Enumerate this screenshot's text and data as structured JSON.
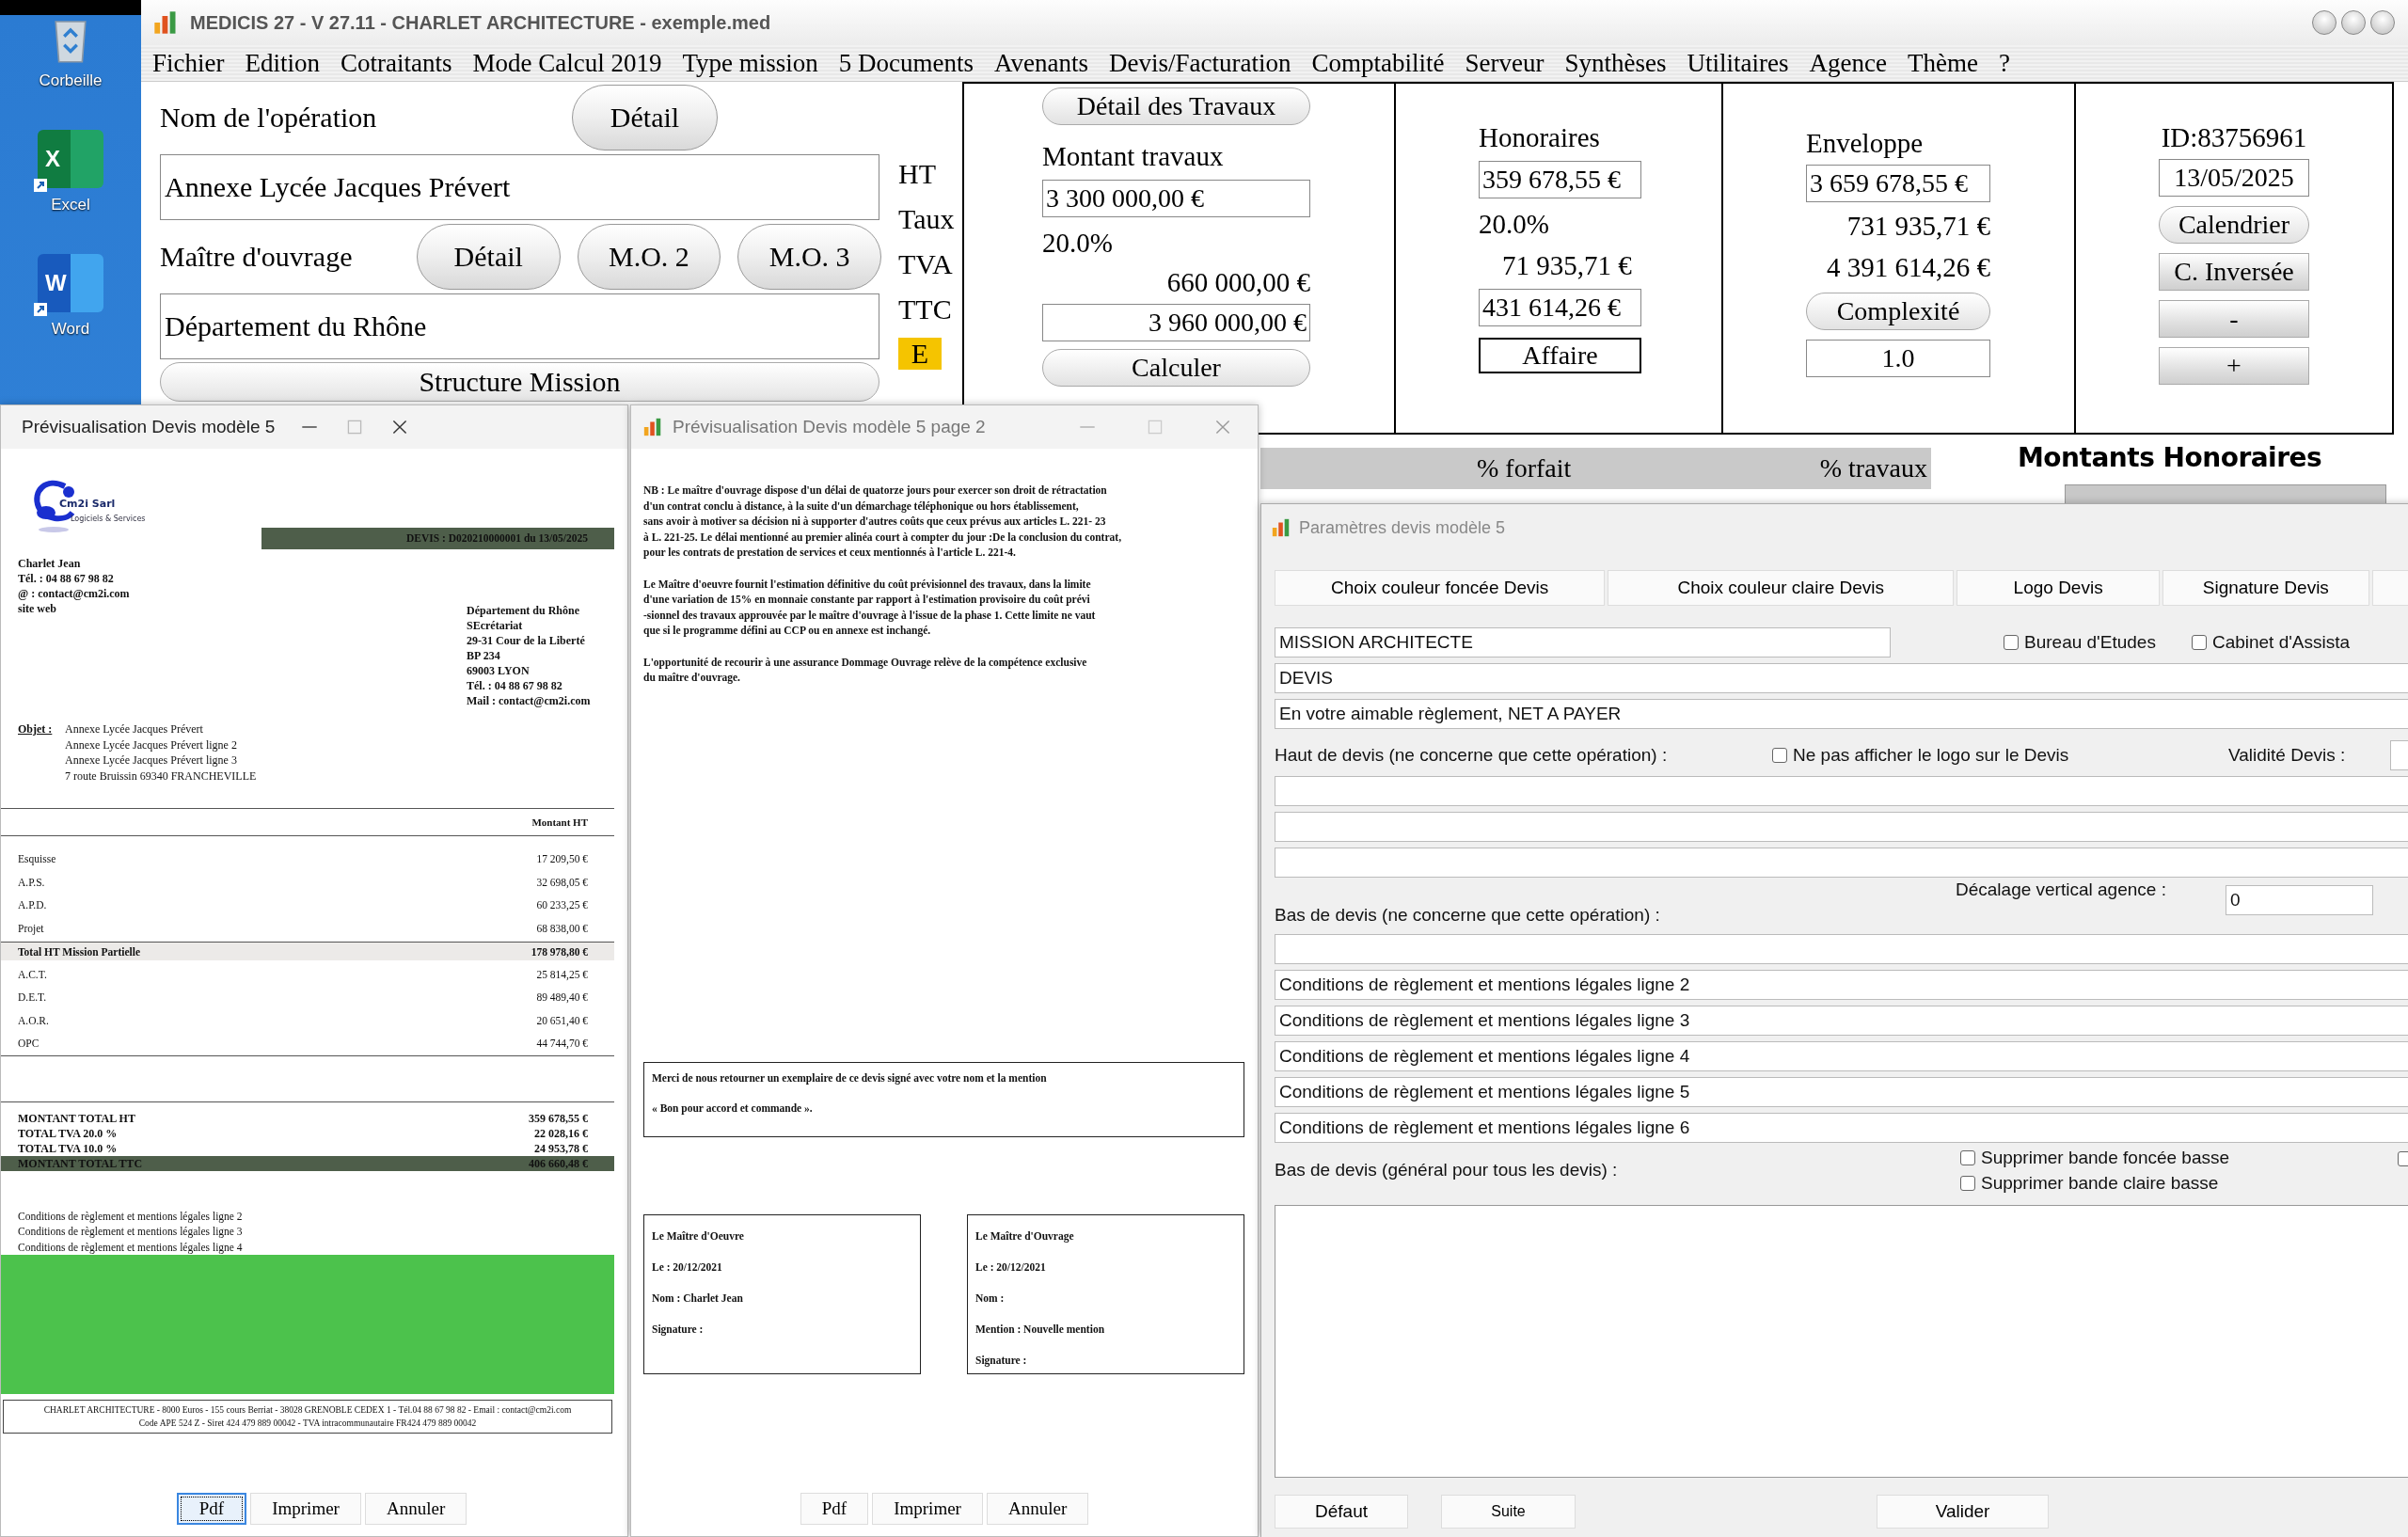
{
  "desktop": {
    "icons": [
      {
        "label": "Corbeille",
        "kind": "recycle"
      },
      {
        "label": "Excel",
        "kind": "excel",
        "glyph": "X"
      },
      {
        "label": "Word",
        "kind": "word",
        "glyph": "W"
      }
    ]
  },
  "main_window": {
    "title": "MEDICIS 27  - V 27.11 - CHARLET ARCHITECTURE - exemple.med",
    "menu": [
      "Fichier",
      "Edition",
      "Cotraitants",
      "Mode Calcul 2019",
      "Type mission",
      "5 Documents",
      "Avenants",
      "Devis/Facturation",
      "Comptabilité",
      "Serveur",
      "Synthèses",
      "Utilitaires",
      "Agence",
      "Thème",
      "?"
    ],
    "operation": {
      "label": "Nom de l'opération",
      "button": "Détail",
      "value": "Annexe Lycée Jacques Prévert"
    },
    "owner": {
      "label": "Maître d'ouvrage",
      "buttons": [
        "Détail",
        "M.O. 2",
        "M.O. 3"
      ],
      "value": "Département du Rhône"
    },
    "structure_button": "Structure Mission",
    "tax_labels": [
      "HT",
      "Taux",
      "TVA",
      "TTC"
    ],
    "e_badge": "E",
    "travaux": {
      "button": "Détail des Travaux",
      "label": "Montant travaux",
      "amount": "3 300 000,00 €",
      "rate": "20.0%",
      "tva": "660 000,00 €",
      "ttc": "3 960 000,00 €",
      "calc_button": "Calculer"
    },
    "honoraires": {
      "label": "Honoraires",
      "ht": "359 678,55 €",
      "rate": "20.0%",
      "tva": "71 935,71 €",
      "ttc": "431 614,26 €",
      "affaire": "Affaire"
    },
    "enveloppe": {
      "label": "Enveloppe",
      "ht": "3 659 678,55 €",
      "tva": "731 935,71 €",
      "ttc": "4 391 614,26 €",
      "button": "Complexité",
      "complexity": "1.0"
    },
    "info": {
      "id": "ID:83756961",
      "date": "13/05/2025",
      "buttons": [
        {
          "label": "Calendrier",
          "kind": "pill"
        },
        {
          "label": "C. Inversée",
          "kind": "bar"
        },
        {
          "label": "-",
          "kind": "bar"
        },
        {
          "label": "+",
          "kind": "bar"
        }
      ]
    },
    "table_headers": [
      "% forfait",
      "% travaux"
    ],
    "chart_title": "Montants Honoraires"
  },
  "preview_1": {
    "title": "Prévisualisation Devis modèle 5",
    "logo": {
      "name": "Cm2i Sarl",
      "tagline": "Logiciels & Services"
    },
    "devis_ref": "DEVIS : D020210000001 du 13/05/2025",
    "sender": [
      "Charlet Jean",
      "Tél. : 04 88 67 98 82",
      "@ : contact@cm2i.com",
      "site web"
    ],
    "recipient": [
      "Département du Rhône",
      "SEcrétariat",
      "29-31 Cour de la Liberté",
      "BP 234",
      "69003 LYON",
      "Tél. : 04 88 67 98 82",
      "Mail : contact@cm2i.com"
    ],
    "object_label": "Objet :",
    "object_lines": [
      "Annexe Lycée Jacques Prévert",
      "Annexe Lycée Jacques Prévert ligne 2",
      "Annexe Lycée Jacques Prévert ligne 3",
      "7 route Bruissin 69340 FRANCHEVILLE"
    ],
    "amount_header": "Montant HT",
    "lines": [
      {
        "label": "Esquisse",
        "amount": "17 209,50 €",
        "kind": "line"
      },
      {
        "label": "A.P.S.",
        "amount": "32 698,05 €",
        "kind": "line"
      },
      {
        "label": "A.P.D.",
        "amount": "60 233,25 €",
        "kind": "line"
      },
      {
        "label": "Projet",
        "amount": "68 838,00 €",
        "kind": "line"
      },
      {
        "label": "Total HT Mission Partielle",
        "amount": "178 978,80 €",
        "kind": "subtotal"
      },
      {
        "label": "A.C.T.",
        "amount": "25 814,25 €",
        "kind": "line"
      },
      {
        "label": "D.E.T.",
        "amount": "89 489,40 €",
        "kind": "line"
      },
      {
        "label": "A.O.R.",
        "amount": "20 651,40 €",
        "kind": "line"
      },
      {
        "label": "OPC",
        "amount": "44 744,70 €",
        "kind": "line"
      }
    ],
    "totals": [
      {
        "label": "MONTANT TOTAL HT",
        "amount": "359 678,55 €",
        "kind": "total"
      },
      {
        "label": "TOTAL TVA 20.0 %",
        "amount": "22 028,16 €",
        "kind": "total"
      },
      {
        "label": "TOTAL TVA 10.0 %",
        "amount": "24 953,78 €",
        "kind": "total"
      },
      {
        "label": "MONTANT TOTAL TTC",
        "amount": "406 660,48 €",
        "kind": "grand"
      }
    ],
    "conditions": [
      "Conditions de règlement et mentions légales ligne 2",
      "Conditions de règlement et mentions légales ligne 3",
      "Conditions de règlement et mentions légales ligne 4"
    ],
    "footer": [
      "CHARLET ARCHITECTURE - 8000 Euros - 155 cours Berriat - 38028 GRENOBLE CEDEX 1 - Tél.04 88 67 98 82 - Email : contact@cm2i.com",
      "Code APE 524 Z - Siret 424 479 889 00042 - TVA intracommunautaire FR424 479 889 00042"
    ],
    "buttons": [
      {
        "label": "Pdf",
        "focused": true
      },
      {
        "label": "Imprimer",
        "focused": false
      },
      {
        "label": "Annuler",
        "focused": false
      }
    ]
  },
  "preview_2": {
    "title": "Prévisualisation Devis modèle 5 page 2",
    "paragraphs": [
      "NB : Le maître d'ouvrage dispose d'un délai de quatorze jours pour exercer son droit de rétractation\nd'un contrat conclu à distance, à la suite d'un démarchage téléphonique ou hors établissement,\nsans avoir à motiver sa décision ni à supporter d'autres coûts que ceux prévus aux articles L. 221- 23\nà L. 221-25. Le délai mentionné au premier alinéa court à compter du jour :De la conclusion du contrat,\npour les contrats de prestation de services et ceux mentionnés à l'article L. 221-4.",
      "Le Maître d'oeuvre fournit l'estimation définitive du coût prévisionnel des travaux, dans la limite\nd'une variation de 15% en monnaie constante par rapport à l'estimation provisoire du coût prévi\n-sionnel des travaux approuvée par le maître d'ouvrage à l'issue de la phase 1. Cette limite ne vaut\nque si le programme défini au CCP ou en annexe est inchangé.",
      "L'opportunité de recourir à une assurance Dommage Ouvrage relève de la compétence exclusive\ndu maître d'ouvrage."
    ],
    "note": [
      "Merci de nous retourner un exemplaire de ce devis signé avec votre nom et la mention",
      "« Bon pour accord et commande »."
    ],
    "signatures": [
      [
        "Le Maître d'Oeuvre",
        "Le : 20/12/2021",
        "Nom : Charlet Jean",
        "Signature :"
      ],
      [
        "Le Maître d'Ouvrage",
        "Le : 20/12/2021",
        "Nom :",
        "Mention : Nouvelle mention",
        "Signature :"
      ]
    ],
    "buttons": [
      {
        "label": "Pdf",
        "focused": false
      },
      {
        "label": "Imprimer",
        "focused": false
      },
      {
        "label": "Annuler",
        "focused": false
      }
    ]
  },
  "params": {
    "title": "Paramètres devis modèle 5",
    "tabs": [
      "Choix couleur foncée Devis",
      "Choix couleur claire Devis",
      "Logo Devis",
      "Signature Devis"
    ],
    "mission": "MISSION ARCHITECTE",
    "roles": [
      {
        "label": "Bureau d'Etudes",
        "checked": false
      },
      {
        "label": "Cabinet d'Assista",
        "checked": false
      }
    ],
    "doc_title": "DEVIS",
    "payment": "En votre aimable règlement, NET A PAYER",
    "header_label": "Haut de devis (ne concerne que cette opération) :",
    "hide_logo": {
      "label": "Ne pas afficher le logo sur le Devis",
      "checked": false
    },
    "validity_label": "Validité Devis :",
    "offset_label": "Décalage vertical agence :",
    "offset_value": "0",
    "footer_label": "Bas de devis  (ne concerne que cette opération) :",
    "footer_lines": [
      "Conditions de règlement et mentions légales ligne 2",
      "Conditions de règlement et mentions légales ligne 3",
      "Conditions de règlement et mentions légales ligne 4",
      "Conditions de règlement et mentions légales ligne 5",
      "Conditions de règlement et mentions légales ligne 6"
    ],
    "general_label": "Bas de devis  (général pour tous les devis) :",
    "band_options": [
      {
        "label": "Supprimer bande foncée basse",
        "checked": false
      },
      {
        "label": "Supprimer bande claire basse",
        "checked": false
      }
    ],
    "edge_option": {
      "checked": false
    },
    "buttons": [
      "Défaut",
      "Suite",
      "Valider"
    ]
  }
}
